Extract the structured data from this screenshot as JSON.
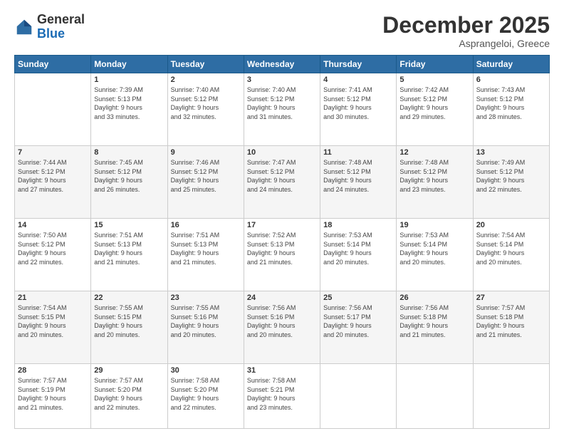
{
  "header": {
    "logo_line1": "General",
    "logo_line2": "Blue",
    "title": "December 2025",
    "subtitle": "Asprangeloi, Greece"
  },
  "columns": [
    "Sunday",
    "Monday",
    "Tuesday",
    "Wednesday",
    "Thursday",
    "Friday",
    "Saturday"
  ],
  "weeks": [
    [
      {
        "day": "",
        "info": ""
      },
      {
        "day": "1",
        "info": "Sunrise: 7:39 AM\nSunset: 5:13 PM\nDaylight: 9 hours\nand 33 minutes."
      },
      {
        "day": "2",
        "info": "Sunrise: 7:40 AM\nSunset: 5:12 PM\nDaylight: 9 hours\nand 32 minutes."
      },
      {
        "day": "3",
        "info": "Sunrise: 7:40 AM\nSunset: 5:12 PM\nDaylight: 9 hours\nand 31 minutes."
      },
      {
        "day": "4",
        "info": "Sunrise: 7:41 AM\nSunset: 5:12 PM\nDaylight: 9 hours\nand 30 minutes."
      },
      {
        "day": "5",
        "info": "Sunrise: 7:42 AM\nSunset: 5:12 PM\nDaylight: 9 hours\nand 29 minutes."
      },
      {
        "day": "6",
        "info": "Sunrise: 7:43 AM\nSunset: 5:12 PM\nDaylight: 9 hours\nand 28 minutes."
      }
    ],
    [
      {
        "day": "7",
        "info": "Sunrise: 7:44 AM\nSunset: 5:12 PM\nDaylight: 9 hours\nand 27 minutes."
      },
      {
        "day": "8",
        "info": "Sunrise: 7:45 AM\nSunset: 5:12 PM\nDaylight: 9 hours\nand 26 minutes."
      },
      {
        "day": "9",
        "info": "Sunrise: 7:46 AM\nSunset: 5:12 PM\nDaylight: 9 hours\nand 25 minutes."
      },
      {
        "day": "10",
        "info": "Sunrise: 7:47 AM\nSunset: 5:12 PM\nDaylight: 9 hours\nand 24 minutes."
      },
      {
        "day": "11",
        "info": "Sunrise: 7:48 AM\nSunset: 5:12 PM\nDaylight: 9 hours\nand 24 minutes."
      },
      {
        "day": "12",
        "info": "Sunrise: 7:48 AM\nSunset: 5:12 PM\nDaylight: 9 hours\nand 23 minutes."
      },
      {
        "day": "13",
        "info": "Sunrise: 7:49 AM\nSunset: 5:12 PM\nDaylight: 9 hours\nand 22 minutes."
      }
    ],
    [
      {
        "day": "14",
        "info": "Sunrise: 7:50 AM\nSunset: 5:12 PM\nDaylight: 9 hours\nand 22 minutes."
      },
      {
        "day": "15",
        "info": "Sunrise: 7:51 AM\nSunset: 5:13 PM\nDaylight: 9 hours\nand 21 minutes."
      },
      {
        "day": "16",
        "info": "Sunrise: 7:51 AM\nSunset: 5:13 PM\nDaylight: 9 hours\nand 21 minutes."
      },
      {
        "day": "17",
        "info": "Sunrise: 7:52 AM\nSunset: 5:13 PM\nDaylight: 9 hours\nand 21 minutes."
      },
      {
        "day": "18",
        "info": "Sunrise: 7:53 AM\nSunset: 5:14 PM\nDaylight: 9 hours\nand 20 minutes."
      },
      {
        "day": "19",
        "info": "Sunrise: 7:53 AM\nSunset: 5:14 PM\nDaylight: 9 hours\nand 20 minutes."
      },
      {
        "day": "20",
        "info": "Sunrise: 7:54 AM\nSunset: 5:14 PM\nDaylight: 9 hours\nand 20 minutes."
      }
    ],
    [
      {
        "day": "21",
        "info": "Sunrise: 7:54 AM\nSunset: 5:15 PM\nDaylight: 9 hours\nand 20 minutes."
      },
      {
        "day": "22",
        "info": "Sunrise: 7:55 AM\nSunset: 5:15 PM\nDaylight: 9 hours\nand 20 minutes."
      },
      {
        "day": "23",
        "info": "Sunrise: 7:55 AM\nSunset: 5:16 PM\nDaylight: 9 hours\nand 20 minutes."
      },
      {
        "day": "24",
        "info": "Sunrise: 7:56 AM\nSunset: 5:16 PM\nDaylight: 9 hours\nand 20 minutes."
      },
      {
        "day": "25",
        "info": "Sunrise: 7:56 AM\nSunset: 5:17 PM\nDaylight: 9 hours\nand 20 minutes."
      },
      {
        "day": "26",
        "info": "Sunrise: 7:56 AM\nSunset: 5:18 PM\nDaylight: 9 hours\nand 21 minutes."
      },
      {
        "day": "27",
        "info": "Sunrise: 7:57 AM\nSunset: 5:18 PM\nDaylight: 9 hours\nand 21 minutes."
      }
    ],
    [
      {
        "day": "28",
        "info": "Sunrise: 7:57 AM\nSunset: 5:19 PM\nDaylight: 9 hours\nand 21 minutes."
      },
      {
        "day": "29",
        "info": "Sunrise: 7:57 AM\nSunset: 5:20 PM\nDaylight: 9 hours\nand 22 minutes."
      },
      {
        "day": "30",
        "info": "Sunrise: 7:58 AM\nSunset: 5:20 PM\nDaylight: 9 hours\nand 22 minutes."
      },
      {
        "day": "31",
        "info": "Sunrise: 7:58 AM\nSunset: 5:21 PM\nDaylight: 9 hours\nand 23 minutes."
      },
      {
        "day": "",
        "info": ""
      },
      {
        "day": "",
        "info": ""
      },
      {
        "day": "",
        "info": ""
      }
    ]
  ]
}
